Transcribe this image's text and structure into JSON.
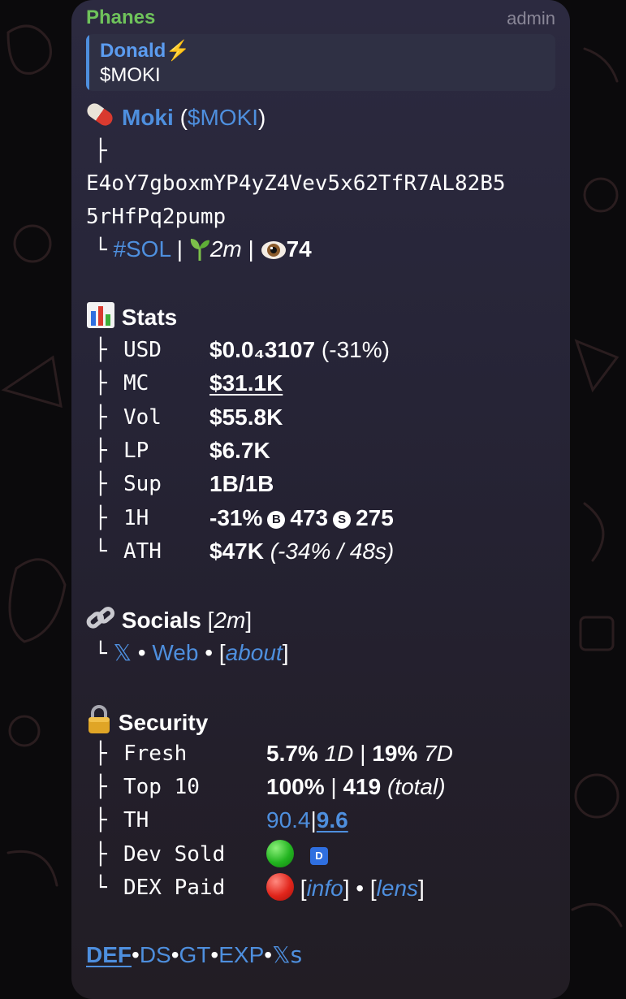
{
  "header": {
    "sender": "Phanes",
    "role": "admin"
  },
  "reply": {
    "name": "Donald⚡",
    "text": "$MOKI"
  },
  "token": {
    "name": "Moki",
    "paren_open": "(",
    "ticker": "$MOKI",
    "paren_close": ")",
    "address_line1": "E4oY7gboxmYP4yZ4Vev5x62TfR7AL82B5",
    "address_line2": "5rHfPq2pump",
    "chain": "#SOL",
    "sep": "|",
    "age": "2m",
    "views": "74"
  },
  "stats": {
    "title": "Stats",
    "rows": [
      {
        "tree": "├",
        "key": "USD",
        "value": "$0.0₄3107",
        "extra": "(-31%)"
      },
      {
        "tree": "├",
        "key": "MC",
        "value": "$31.1K",
        "extra": ""
      },
      {
        "tree": "├",
        "key": "Vol",
        "value": "$55.8K",
        "extra": ""
      },
      {
        "tree": "├",
        "key": "LP",
        "value": "$6.7K",
        "extra": ""
      },
      {
        "tree": "├",
        "key": "Sup",
        "value": "1B/1B",
        "extra": ""
      },
      {
        "tree": "├",
        "key": "1H",
        "value": "-31%",
        "buys_icon": "B",
        "buys": "473",
        "sells_icon": "S",
        "sells": "275"
      },
      {
        "tree": "└",
        "key": "ATH",
        "value": "$47K",
        "extra": "(-34% / 48s)"
      }
    ]
  },
  "socials": {
    "title": "Socials",
    "age_open": "[",
    "age": "2m",
    "age_close": "]",
    "tree": "└",
    "x": "𝕏",
    "dot": "•",
    "web": "Web",
    "about_open": "[",
    "about": "about",
    "about_close": "]"
  },
  "security": {
    "title": "Security",
    "fresh": {
      "tree": "├",
      "key": "Fresh",
      "v1": "5.7%",
      "p1": "1D",
      "sep": "|",
      "v2": "19%",
      "p2": "7D"
    },
    "top10": {
      "tree": "├",
      "key": "Top 10",
      "v1": "100%",
      "sep": "|",
      "v2": "419",
      "note": "(total)"
    },
    "th": {
      "tree": "├",
      "key": "TH",
      "v1": "90.4",
      "sep": "|",
      "v2": "9.6"
    },
    "dev_sold": {
      "tree": "├",
      "key": "Dev Sold",
      "badge": "D",
      "status_color": "#22b420"
    },
    "dex_paid": {
      "tree": "└",
      "key": "DEX Paid",
      "status_color": "#e1251b",
      "open": "[",
      "info": "info",
      "close": "]",
      "dot": "•",
      "open2": "[",
      "lens": "lens",
      "close2": "]"
    }
  },
  "footer": {
    "links": [
      "DEF",
      "DS",
      "GT",
      "EXP",
      "𝕏s"
    ],
    "dot": "•"
  },
  "colors": {
    "accent": "#4e8fde",
    "sender": "#6fc35b",
    "bubble": "#2a283b"
  }
}
